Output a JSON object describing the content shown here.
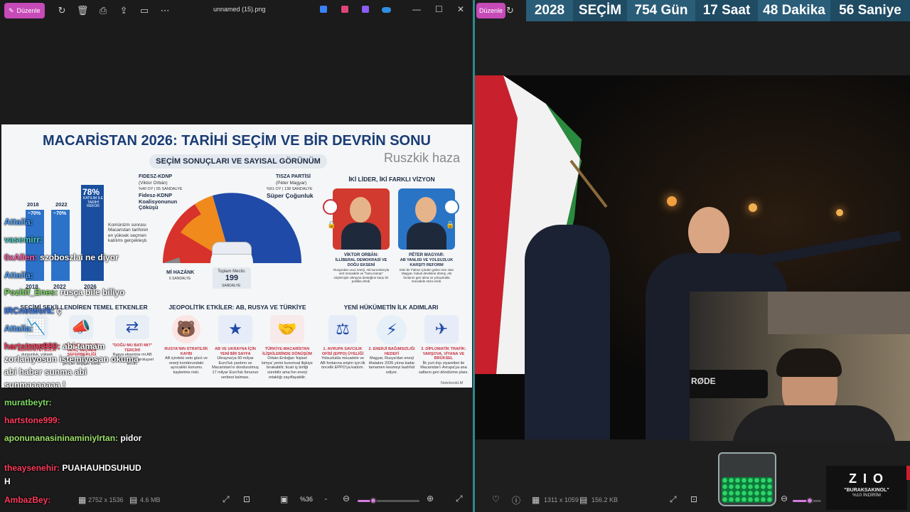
{
  "left_viewer": {
    "edit_label": "Düzenle",
    "file_title": "unnamed (15).png",
    "status": {
      "dimensions": "2752 x 1536",
      "size": "4.6 MB",
      "zoom": "%36"
    },
    "zoom_slider_fraction": 0.25
  },
  "right_viewer": {
    "edit_label": "Düzenle",
    "status": {
      "dimensions": "1311 x 1059",
      "size": "156.2 KB"
    },
    "zoom_slider_fraction": 0.6
  },
  "countdown": {
    "year": "2028",
    "label": "SEÇİM",
    "days": "754 Gün",
    "hours": "17 Saat",
    "minutes": "48 Dakika",
    "seconds": "56 Saniye"
  },
  "infographic": {
    "title": "MACARİSTAN 2026: TARİHİ SEÇİM VE BİR DEVRİN SONU",
    "subtitle": "SEÇİM SONUÇLARI VE SAYISAL GÖRÜNÜM",
    "overlay_text": "Ruszkik haza",
    "turnout": {
      "years": [
        "2018",
        "2022",
        "2026"
      ],
      "values": [
        "~70%",
        "~70%",
        "78%"
      ],
      "record_label": "KATILIM İLE TARİHİ REKOR",
      "note": "Komünizm sonrası Macaristan tarihinin en yüksek seçmen katılımı gerçekleşti."
    },
    "fidesz": {
      "party": "FIDESZ-KDNP",
      "leader": "(Viktor Orbán)",
      "result": "%40 OY | 55 SANDALYE",
      "headline": "Fidesz-KDNP Koalisyonunun Çöküşü"
    },
    "tisza": {
      "party": "TISZA PARTİSİ",
      "leader": "(Péter Magyar)",
      "result": "%51 OY | 138 SANDALYE",
      "headline": "Süper Çoğunluk"
    },
    "mi_hazank": {
      "name": "Mİ HAZÁNK",
      "seats": "6 SANDALYE"
    },
    "parliament": {
      "label": "Toplam Meclis:",
      "total": "199",
      "unit": "SANDALYE"
    },
    "leaders_title": "İKİ LİDER, İKİ FARKLI VİZYON",
    "orban": {
      "name": "VİKTOR ORBÁN:",
      "desc": "İLLİBERAL DEMOKRASİ VE DOĞU EKSENİ",
      "body": "Rusya'dan ucuz enerji, AB kurumlarıyla sert mücadele ve \"hanu kampı\" söylemiyle Ukrayna desteğine karşı bir politika izledi."
    },
    "magyar": {
      "name": "PÉTER MAGYAR:",
      "desc": "AB YANLISI VE YOLSUZLUK KARŞITI REFORM",
      "body": "Eski bir Fidesz içinden gelen isim olan Magyar, hukuk devletine dönüş, AB fonlarını geri alma ve yolsuzlukla mücadele sözü verdi."
    },
    "factors_title": "SEÇİMİ ŞEKİLLENDİREN TEMEL ETKENLER",
    "factors": [
      {
        "label": "EKONOMİK MEMNUNİYETSİZLİK",
        "body": "durgunluk, yüksek enflasyon"
      },
      {
        "label": "SKANDALLAR VE GENÇ SEÇMEN SEFERBERLİĞİ",
        "body": "davası ağı skandalı, gençler değişim istedi."
      },
      {
        "label": "\"DOĞU MU BATI MI?\" TERCİHİ",
        "body": "Rusya eksenine mi AB ortağı üzerine varoluşsel tercih."
      }
    ],
    "geo_title": "JEOPOLİTİK ETKİLER: AB, RUSYA VE TÜRKİYE",
    "geo": [
      {
        "label": "RUSYA'NIN STRATEJİK KAYBI",
        "body": "AB içindeki veto gücü ve enerji koridorundaki ayrıcalıklı konumu kaybetme riski."
      },
      {
        "label": "AB VE UKRAYNA İÇİN YENİ BİR SAYFA",
        "body": "Ukrayna'ya 90 milyar Euro'luk yardımı ve Macaristan'ın dondurulmuş 17 milyar Euro'luk fonunun serbest kalması."
      },
      {
        "label": "TÜRKİYE-MACARİSTAN İLİŞKİLERİNDE DÖNÜŞÜM",
        "body": "Orbán-Erdoğan 'kişisel kimya' yerini kurumsal ilişkiye bırakabilir; ticari iş birliği sürebilir ama fon enerji ortaklığı zayıflayabilir."
      }
    ],
    "steps_title": "YENİ HÜKÜMETİN İLK ADIMLARI",
    "steps": [
      {
        "label": "1. AVRUPA SAVCILIK OFİSİ (EPPO) ÜYELİĞİ",
        "body": "Yolsuzlukla mücadele ve AB fonlarına erişim için ilk öncelik EPPO'ya katılım."
      },
      {
        "label": "2. ENERJİ BAĞIMSIZLIĞI HEDEFİ",
        "body": "Magyar, Rusya'dan enerji ithalatını 2035 yılına kadar tamamen kesmeyi taahhüt ediyor."
      },
      {
        "label": "3. DİPLOMATİK TRAFİK: VARŞOVA, VİYANA VE BRÜKSEL",
        "body": "İlk yurt dışı ziyaretleri ile Macaristan'ı Avrupa'ya ana safların geri döndürme planı."
      }
    ],
    "credit": "NotebookLM"
  },
  "chat": [
    {
      "user": "Attaila:",
      "msg": "",
      "color": "#4fa3ff"
    },
    {
      "user": "vasemirr:",
      "msg": "",
      "color": "#4fd1c5"
    },
    {
      "user": "0xAllen:",
      "msg": "szoboszlai ne diyor",
      "color": "#ff5aa8"
    },
    {
      "user": "Attaila:",
      "msg": "",
      "color": "#4fa3ff"
    },
    {
      "user": "Pozitif_Enes:",
      "msg": "rusça bile biliyo",
      "color": "#7ddc62"
    },
    {
      "user": "IRCnetwork:",
      "msg": "ç",
      "color": "#3b82f6"
    },
    {
      "user": "Attaila:",
      "msg": "",
      "color": "#4fa3ff"
    },
    {
      "user": "hartstone999:",
      "msg": "abi tamam",
      "color": "#ff3a5c"
    },
    {
      "user": "",
      "msg": "zorlanıyosun istemiyosan okuma",
      "color": "#fff"
    },
    {
      "user": "",
      "msg": "abi haber sunma abi",
      "color": "#fff"
    },
    {
      "user": "",
      "msg": "sunmaaaaaaa !",
      "color": "#fff"
    },
    {
      "user": "muratbeytr:",
      "msg": "",
      "color": "#7ddc62"
    },
    {
      "user": "hartstone999:",
      "msg": "",
      "color": "#ff3a5c"
    },
    {
      "user": "aponunanasininaminiyIrtan:",
      "msg": "pidor",
      "color": "#9ee06a"
    },
    {
      "user": "theaysenehir:",
      "msg": "PUAHAUHDSUHUD",
      "color": "#ff3a5c"
    },
    {
      "user": "",
      "msg": "H",
      "color": "#fff"
    },
    {
      "user": "AmbazBey:",
      "msg": "",
      "color": "#ff3a5c"
    }
  ],
  "webcam": {
    "mic_brand": "RØDE"
  },
  "promo": {
    "brand": "Z I O",
    "code": "\"BURAKSAKINOL\"",
    "discount": "%10 İNDİRİM"
  },
  "colors": {
    "accent_edit": "#c64ab7",
    "banner": "#1f4b63",
    "fidesz_orange": "#f08a1c",
    "tisza_blue": "#1f4aa8"
  }
}
